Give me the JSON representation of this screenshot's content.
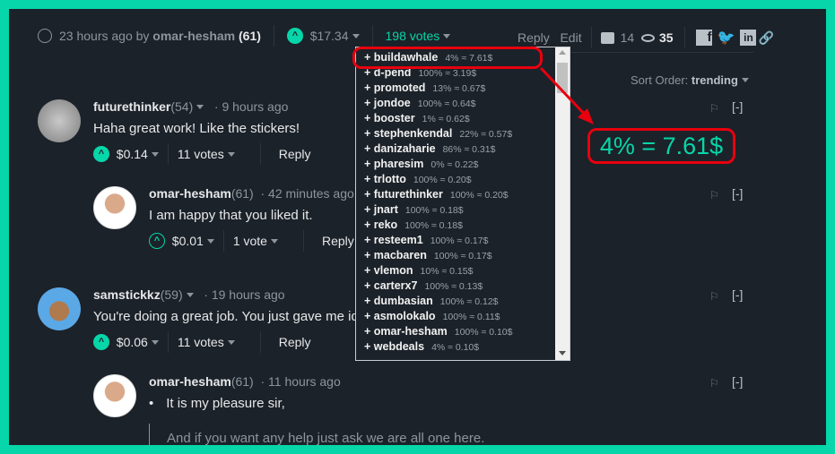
{
  "post": {
    "time": "23 hours ago by",
    "author": "omar-hesham",
    "rep": "(61)",
    "payout": "$17.34",
    "votes": "198 votes",
    "reply": "Reply",
    "edit": "Edit",
    "comments": "14",
    "views": "35"
  },
  "sort": {
    "label": "Sort Order:",
    "value": "trending"
  },
  "voters": [
    {
      "name": "+ buildawhale",
      "info": "4% ≈ 7.61$"
    },
    {
      "name": "+ d-pend",
      "info": "100% ≈ 3.19$"
    },
    {
      "name": "+ promoted",
      "info": "13% ≈ 0.67$"
    },
    {
      "name": "+ jondoe",
      "info": "100% ≈ 0.64$"
    },
    {
      "name": "+ booster",
      "info": "1% ≈ 0.62$"
    },
    {
      "name": "+ stephenkendal",
      "info": "22% ≈ 0.57$"
    },
    {
      "name": "+ danizaharie",
      "info": "86% ≈ 0.31$"
    },
    {
      "name": "+ pharesim",
      "info": "0% ≈ 0.22$"
    },
    {
      "name": "+ trlotto",
      "info": "100% ≈ 0.20$"
    },
    {
      "name": "+ futurethinker",
      "info": "100% ≈ 0.20$"
    },
    {
      "name": "+ jnart",
      "info": "100% ≈ 0.18$"
    },
    {
      "name": "+ reko",
      "info": "100% ≈ 0.18$"
    },
    {
      "name": "+ resteem1",
      "info": "100% ≈ 0.17$"
    },
    {
      "name": "+ macbaren",
      "info": "100% ≈ 0.17$"
    },
    {
      "name": "+ vlemon",
      "info": "10% ≈ 0.15$"
    },
    {
      "name": "+ carterx7",
      "info": "100% ≈ 0.13$"
    },
    {
      "name": "+ dumbasian",
      "info": "100% ≈ 0.12$"
    },
    {
      "name": "+ asmolokalo",
      "info": "100% ≈ 0.11$"
    },
    {
      "name": "+ omar-hesham",
      "info": "100% ≈ 0.10$"
    },
    {
      "name": "+ webdeals",
      "info": "4% ≈ 0.10$"
    }
  ],
  "annotation": "4% = 7.61$",
  "comments": [
    {
      "name": "futurethinker",
      "rep": "(54)",
      "time": "· 9 hours ago",
      "text": "Haha great work! Like the stickers!",
      "payout": "$0.14",
      "votes": "11 votes",
      "reply": "Reply",
      "collapse": "[-]"
    },
    {
      "name": "omar-hesham",
      "rep": "(61)",
      "time": "· 42 minutes ago",
      "text": "I am happy that you liked it.",
      "payout": "$0.01",
      "votes": "1 vote",
      "reply": "Reply",
      "collapse": "[-]"
    },
    {
      "name": "samstickkz",
      "rep": "(59)",
      "time": "· 19 hours ago",
      "text": "You're doing a great job. You just gave me id",
      "payout": "$0.06",
      "votes": "11 votes",
      "reply": "Reply",
      "collapse": "[-]"
    },
    {
      "name": "omar-hesham",
      "rep": "(61)",
      "time": "· 11 hours ago",
      "text": "It is my pleasure sir,",
      "text2": "And if you want any help just ask we are all one here.",
      "collapse": "[-]"
    }
  ],
  "colors": {
    "accent": "#06d6a9",
    "annotation": "#e8000e",
    "background": "#1c2229"
  }
}
